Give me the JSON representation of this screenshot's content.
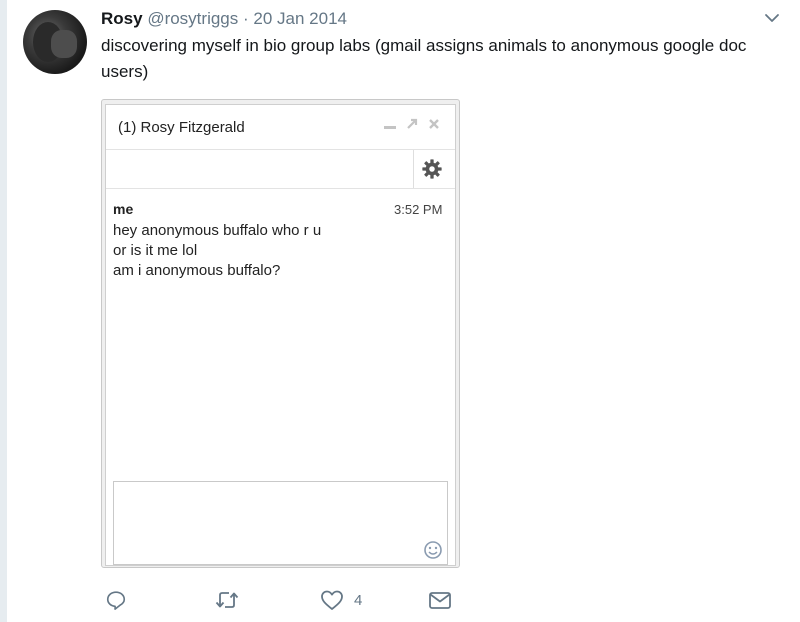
{
  "tweet": {
    "author_name": "Rosy",
    "author_handle": "@rosytriggs",
    "separator": "·",
    "date": "20 Jan 2014",
    "text": "discovering myself in bio group labs (gmail assigns animals to anonymous google doc users)",
    "like_count": "4"
  },
  "media": {
    "chat_title": "(1) Rosy Fitzgerald",
    "message": {
      "sender": "me",
      "time": "3:52 PM",
      "lines": [
        "hey anonymous buffalo who r u",
        "or is it me lol",
        "am i anonymous buffalo?"
      ]
    }
  },
  "icons": {
    "dropdown": "chevron-down-icon",
    "reply": "reply-icon",
    "retweet": "retweet-icon",
    "like": "heart-icon",
    "message": "envelope-icon",
    "settings": "gear-icon",
    "emoji": "smiley-icon"
  },
  "colors": {
    "secondary_text": "#657786",
    "icon": "#657786",
    "rail": "#e6ecf0"
  }
}
